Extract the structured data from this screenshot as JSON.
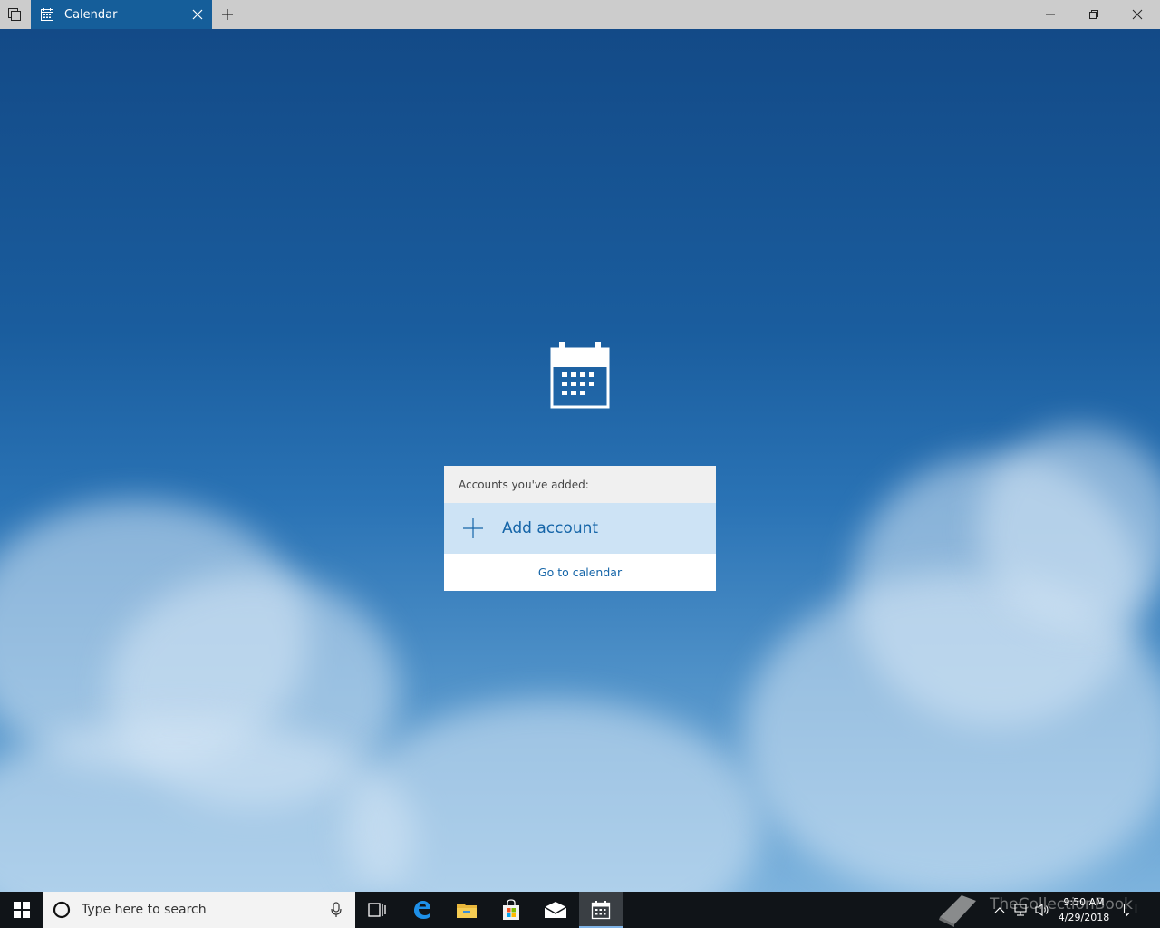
{
  "titlebar": {
    "tab_title": "Calendar"
  },
  "panel": {
    "header": "Accounts you've added:",
    "add_account_label": "Add account",
    "goto_calendar_label": "Go to calendar"
  },
  "taskbar": {
    "search_placeholder": "Type here to search",
    "watermark": "TheCollectionBook",
    "clock_time": "9:50 AM",
    "clock_date": "4/29/2018"
  },
  "colors": {
    "accent": "#155e9a",
    "link": "#1565a8",
    "add_account_bg": "#cde3f5",
    "taskbar_bg": "#101418"
  }
}
